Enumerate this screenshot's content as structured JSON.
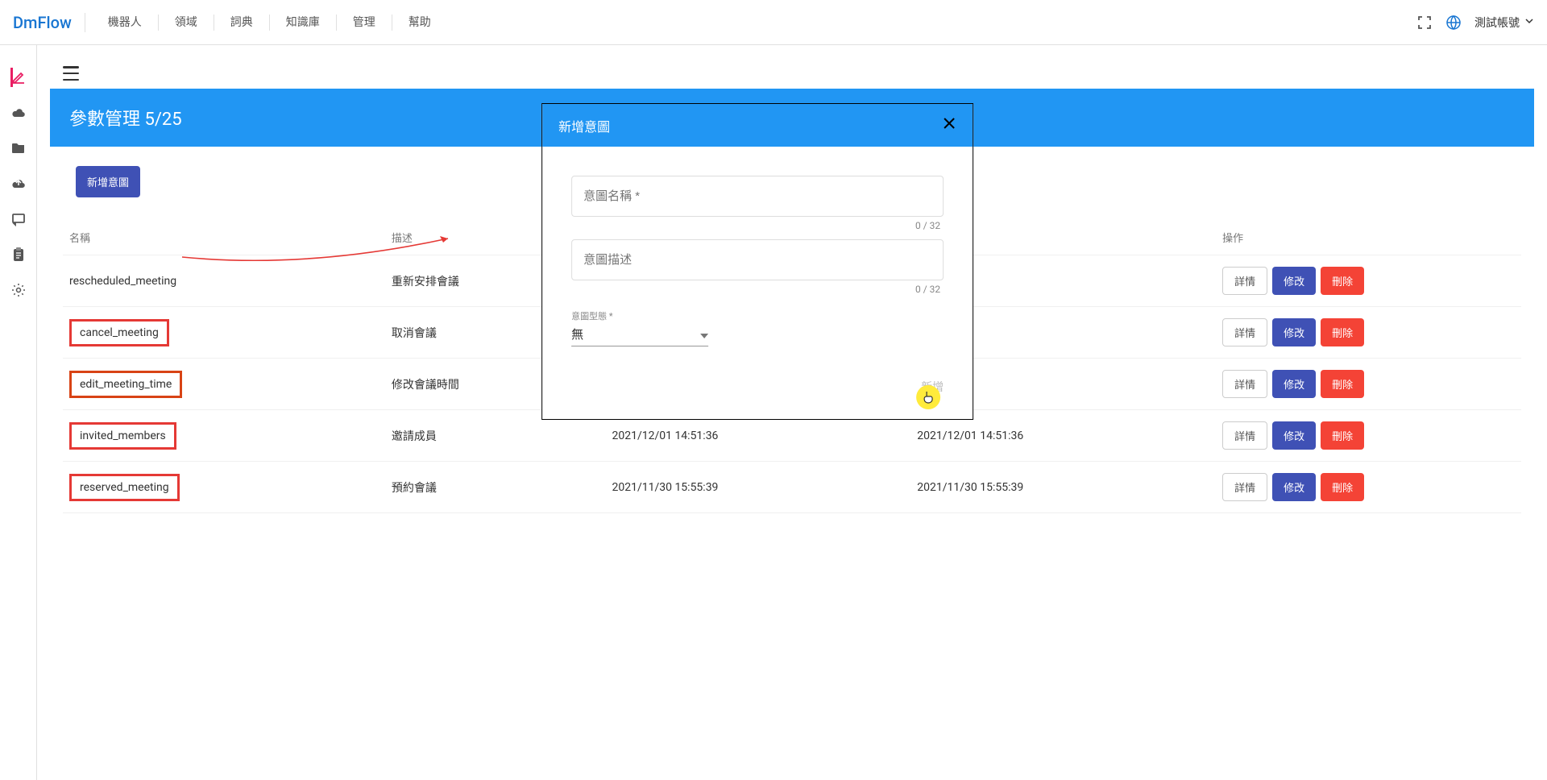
{
  "brand": "DmFlow",
  "nav": {
    "items": [
      "機器人",
      "領域",
      "詞典",
      "知識庫",
      "管理",
      "幫助"
    ],
    "account": "測試帳號"
  },
  "page": {
    "title": "參數管理 5/25",
    "addButton": "新增意圖"
  },
  "table": {
    "headers": {
      "name": "名稱",
      "desc": "描述",
      "actions": "操作"
    },
    "rows": [
      {
        "name": "rescheduled_meeting",
        "desc": "重新安排會議",
        "created": "",
        "updated": "",
        "highlight": ""
      },
      {
        "name": "cancel_meeting",
        "desc": "取消會議",
        "created": "",
        "updated": "",
        "highlight": "red"
      },
      {
        "name": "edit_meeting_time",
        "desc": "修改會議時間",
        "created": "",
        "updated": "",
        "highlight": "orange"
      },
      {
        "name": "invited_members",
        "desc": "邀請成員",
        "created": "2021/12/01 14:51:36",
        "updated": "2021/12/01 14:51:36",
        "highlight": "red"
      },
      {
        "name": "reserved_meeting",
        "desc": "預約會議",
        "created": "2021/11/30 15:55:39",
        "updated": "2021/11/30 15:55:39",
        "highlight": "red"
      }
    ],
    "actionLabels": {
      "detail": "詳情",
      "edit": "修改",
      "delete": "刪除"
    }
  },
  "modal": {
    "title": "新增意圖",
    "nameLabel": "意圖名稱 *",
    "nameCounter": "0 / 32",
    "descLabel": "意圖描述",
    "descCounter": "0 / 32",
    "typeLabel": "意圖型態 *",
    "typeValue": "無",
    "confirm": "新增"
  }
}
